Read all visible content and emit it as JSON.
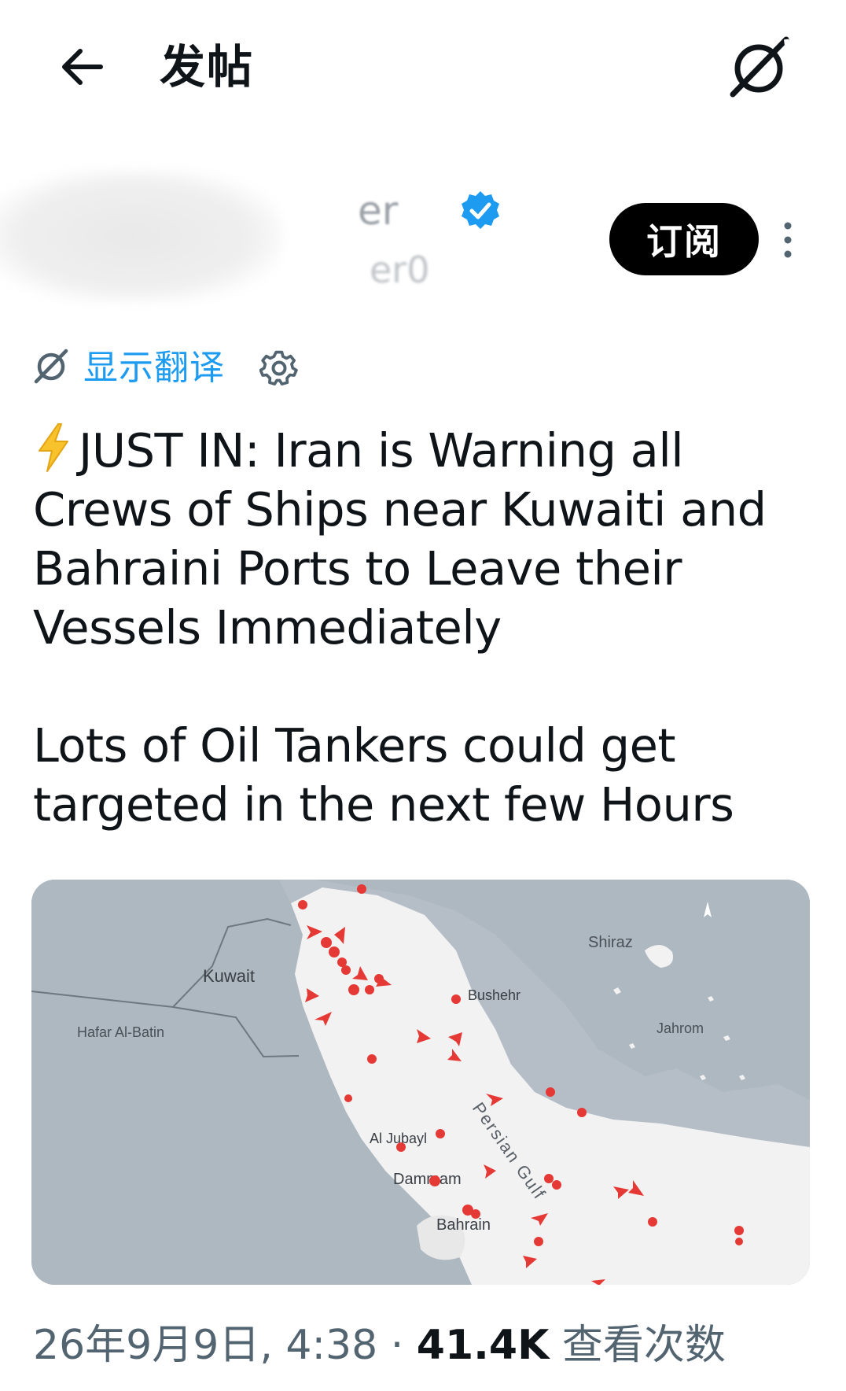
{
  "header": {
    "title": "发帖"
  },
  "author": {
    "name": "er",
    "handle": "er0",
    "subscribe_label": "订阅"
  },
  "translation": {
    "show_label": "显示翻译"
  },
  "post": {
    "paragraph_1": "JUST IN: Iran is Warning all Crews of Ships near Kuwaiti and Bahraini Ports to Leave their Vessels Immediately",
    "paragraph_2": "Lots of Oil Tankers could get targeted in the next few Hours",
    "lead_emoji": "lightning-icon"
  },
  "map": {
    "labels": {
      "kuwait": "Kuwait",
      "hafar": "Hafar Al-Batin",
      "shiraz": "Shiraz",
      "bushehr": "Bushehr",
      "jahrom": "Jahrom",
      "al_jubayl": "Al Jubayl",
      "dammam": "Dammam",
      "bahrain": "Bahrain",
      "persian_gulf": "Persian Gulf"
    },
    "colors": {
      "water": "#b5bec7",
      "land": "#f2f2f2",
      "marker": "#e53935"
    }
  },
  "meta": {
    "date": "26年9月9日,",
    "time": "4:38",
    "separator": "·",
    "views_count": "41.4K",
    "views_label": "查看次数"
  },
  "colors": {
    "accent": "#1d9bf0",
    "verified": "#1d9bf0",
    "text": "#0f1419",
    "secondary": "#536471"
  }
}
